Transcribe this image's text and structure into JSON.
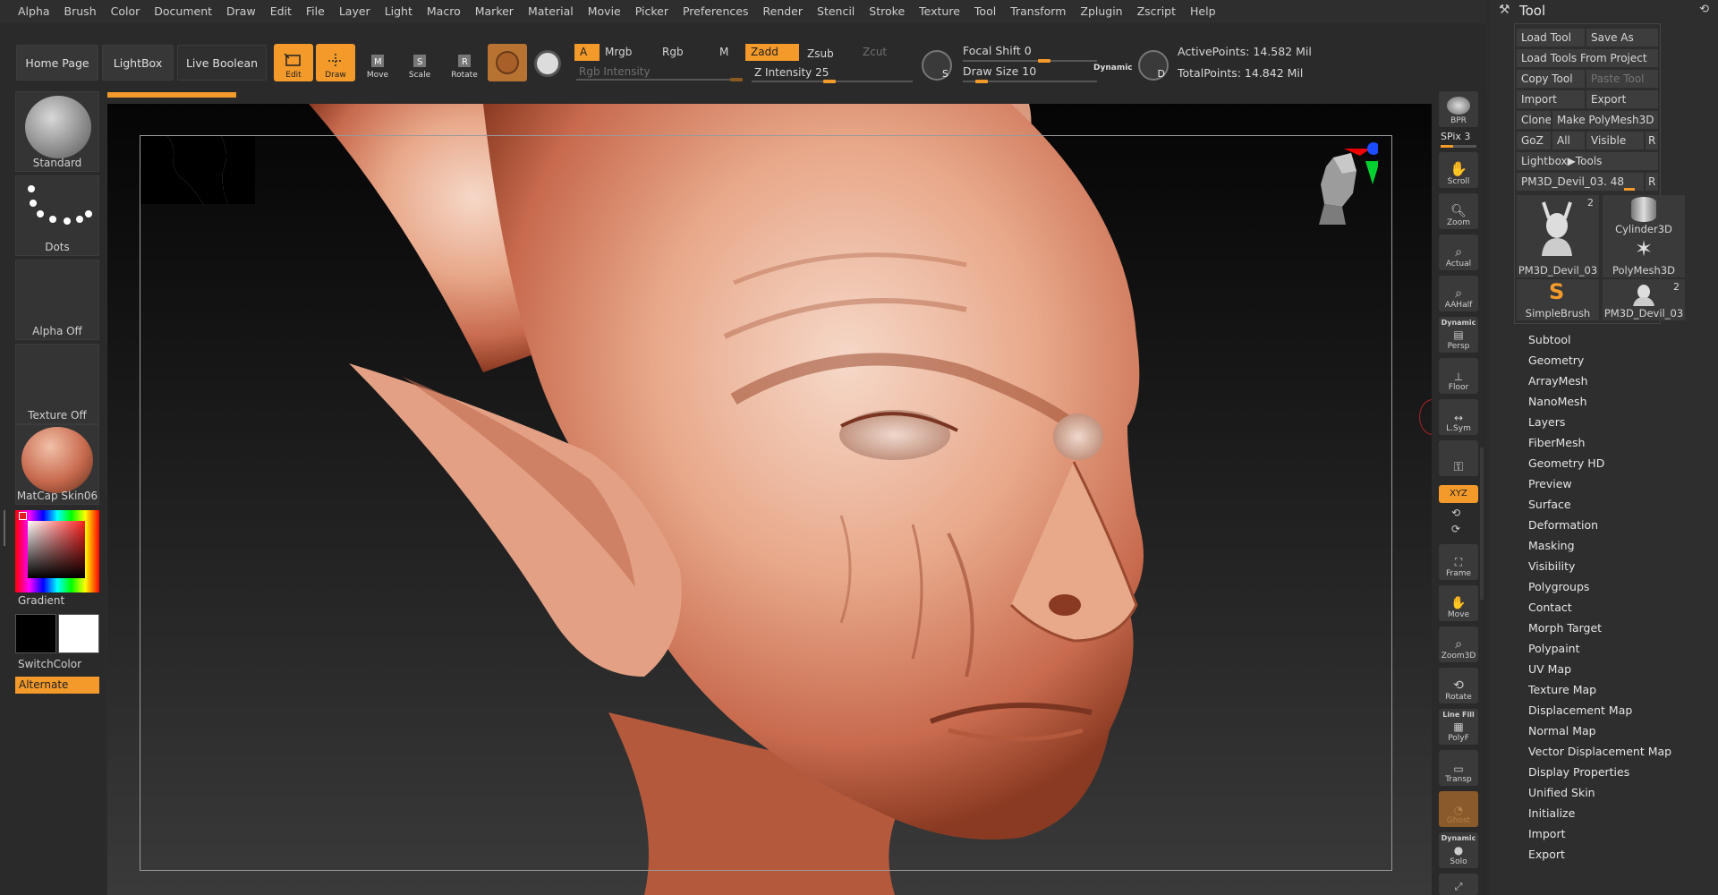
{
  "menu": [
    "Alpha",
    "Brush",
    "Color",
    "Document",
    "Draw",
    "Edit",
    "File",
    "Layer",
    "Light",
    "Macro",
    "Marker",
    "Material",
    "Movie",
    "Picker",
    "Preferences",
    "Render",
    "Stencil",
    "Stroke",
    "Texture",
    "Tool",
    "Transform",
    "Zplugin",
    "Zscript",
    "Help"
  ],
  "topbar": {
    "home_page": "Home Page",
    "lightbox": "LightBox",
    "live_boolean": "Live Boolean",
    "tools": {
      "edit": "Edit",
      "draw": "Draw",
      "move": "Move",
      "scale": "Scale",
      "rotate": "Rotate"
    },
    "modes": {
      "a": "A",
      "mrgb": "Mrgb",
      "rgb": "Rgb",
      "m": "M",
      "zadd": "Zadd",
      "zsub": "Zsub",
      "zcut": "Zcut"
    },
    "rgb_intensity": "Rgb Intensity",
    "z_intensity": "Z Intensity 25",
    "focal_shift": "Focal Shift 0",
    "draw_size": "Draw Size 10",
    "dynamic": "Dynamic",
    "active_points": "ActivePoints: 14.582 Mil",
    "total_points": "TotalPoints: 14.842 Mil",
    "s_label": "S",
    "d_label": "D"
  },
  "left": {
    "brush": "Standard",
    "stroke": "Dots",
    "alpha": "Alpha Off",
    "texture": "Texture Off",
    "material": "MatCap Skin06",
    "gradient": "Gradient",
    "switchcolor": "SwitchColor",
    "alternate": "Alternate",
    "colors": {
      "accent": "#f39a2b",
      "skin": "#c86a4e",
      "main": "#000000",
      "secondary": "#ffffff"
    }
  },
  "shelf": {
    "bpr": "BPR",
    "spix": "SPix 3",
    "scroll": "Scroll",
    "zoom": "Zoom",
    "actual": "Actual",
    "aahalf": "AAHalf",
    "dynamic": "Dynamic",
    "persp": "Persp",
    "floor": "Floor",
    "lsym": "L.Sym",
    "xyz": "XYZ",
    "frame": "Frame",
    "move": "Move",
    "zoom3d": "Zoom3D",
    "rotate": "Rotate",
    "linefill": "Line Fill",
    "polyf": "PolyF",
    "transp": "Transp",
    "ghost": "Ghost",
    "dynamic2": "Dynamic",
    "solo": "Solo"
  },
  "tool": {
    "title": "Tool",
    "load_tool": "Load Tool",
    "save_as": "Save As",
    "load_from_project": "Load Tools From Project",
    "copy_tool": "Copy Tool",
    "paste_tool": "Paste Tool",
    "import": "Import",
    "export": "Export",
    "clone": "Clone",
    "make_polymesh": "Make PolyMesh3D",
    "goz": "GoZ",
    "all": "All",
    "visible": "Visible",
    "r": "R",
    "lightbox_tools": "Lightbox▶Tools",
    "current_tool": "PM3D_Devil_03. 48",
    "thumbs": [
      {
        "label": "PM3D_Devil_03",
        "count": "2"
      },
      {
        "label": "Cylinder3D",
        "count": ""
      },
      {
        "label": "PolyMesh3D",
        "count": ""
      },
      {
        "label": "SimpleBrush",
        "count": ""
      },
      {
        "label": "PM3D_Devil_03",
        "count": "2"
      }
    ],
    "subpalettes": [
      "Subtool",
      "Geometry",
      "ArrayMesh",
      "NanoMesh",
      "Layers",
      "FiberMesh",
      "Geometry HD",
      "Preview",
      "Surface",
      "Deformation",
      "Masking",
      "Visibility",
      "Polygroups",
      "Contact",
      "Morph Target",
      "Polypaint",
      "UV Map",
      "Texture Map",
      "Displacement Map",
      "Normal Map",
      "Vector Displacement Map",
      "Display Properties",
      "Unified Skin",
      "Initialize",
      "Import",
      "Export"
    ]
  }
}
